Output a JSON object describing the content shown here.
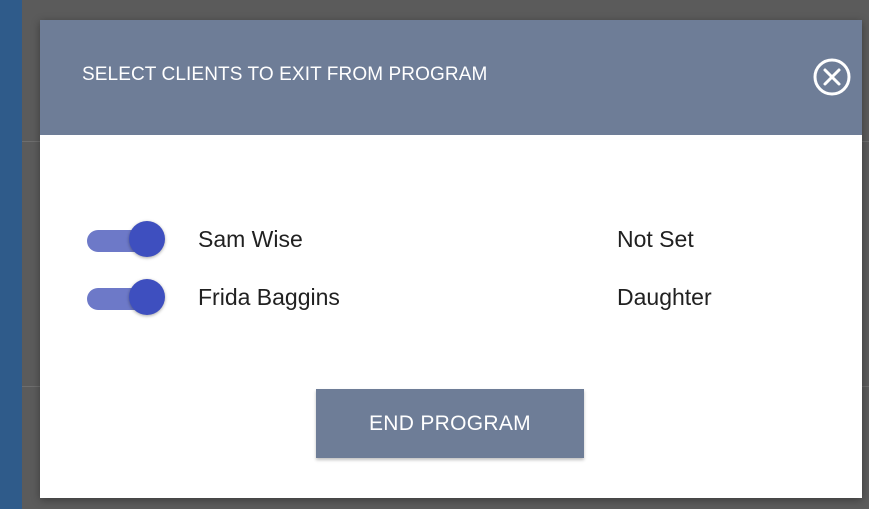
{
  "dialog": {
    "title": "SELECT CLIENTS TO EXIT FROM PROGRAM",
    "close_icon": "close-circle-icon",
    "clients": [
      {
        "name": "Sam Wise",
        "relation": "Not Set",
        "selected": true
      },
      {
        "name": "Frida Baggins",
        "relation": "Daughter",
        "selected": true
      }
    ],
    "end_button_label": "END PROGRAM"
  },
  "colors": {
    "header": "#6e7d97",
    "toggle_track": "#6d79c8",
    "toggle_knob": "#3e4fbf",
    "page_background": "#2f5b8a"
  }
}
